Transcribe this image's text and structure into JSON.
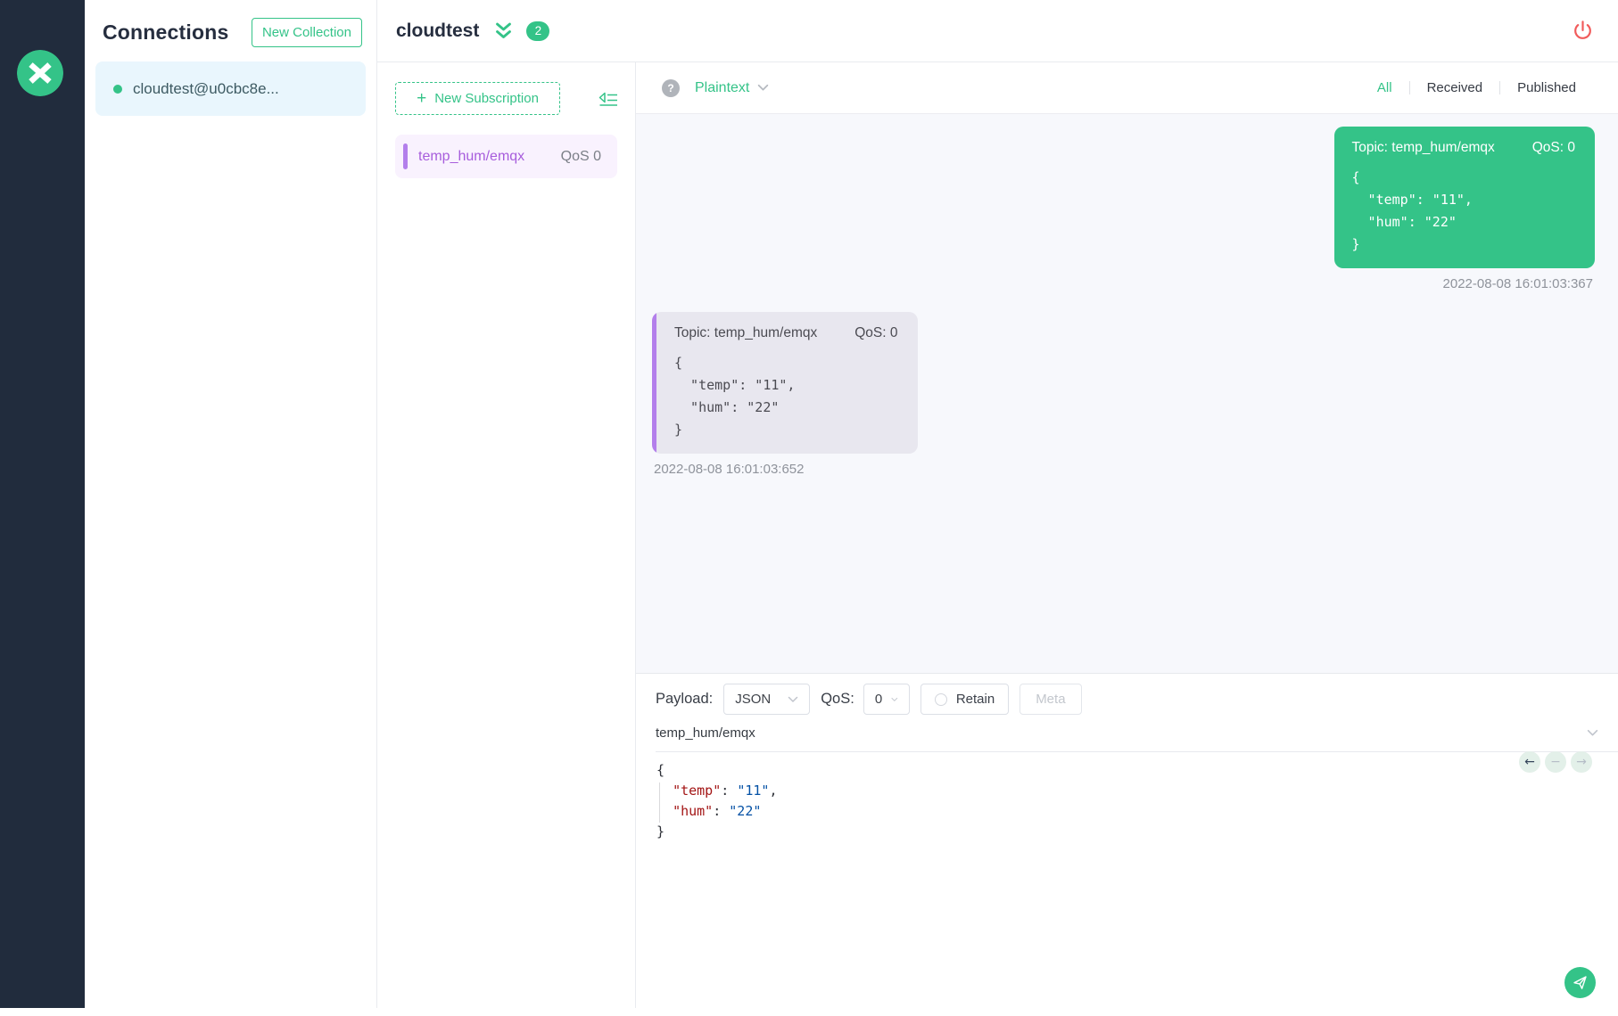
{
  "colors": {
    "brand_green": "#34c388",
    "purple": "#b37feb",
    "danger_red": "#f15b5b"
  },
  "connections_panel": {
    "title": "Connections",
    "new_collection_button": "New Collection",
    "items": [
      {
        "name": "cloudtest@u0cbc8e...",
        "status": "connected"
      }
    ]
  },
  "header": {
    "connection_title": "cloudtest",
    "subscriptions_badge": "2"
  },
  "subscriptions_panel": {
    "new_subscription_button": "New Subscription",
    "plus": "+",
    "items": [
      {
        "topic": "temp_hum/emqx",
        "qos": "QoS 0"
      }
    ]
  },
  "message_toolbar": {
    "help": "?",
    "format_selector": "Plaintext",
    "tabs": [
      {
        "label": "All",
        "active": true
      },
      {
        "label": "Received",
        "active": false
      },
      {
        "label": "Published",
        "active": false
      }
    ]
  },
  "messages": [
    {
      "direction": "published",
      "topic": "Topic: temp_hum/emqx",
      "qos": "QoS: 0",
      "payload": "{\n  \"temp\": \"11\",\n  \"hum\": \"22\"\n}",
      "timestamp": "2022-08-08 16:01:03:367"
    },
    {
      "direction": "received",
      "topic": "Topic: temp_hum/emqx",
      "qos": "QoS: 0",
      "payload": "{\n  \"temp\": \"11\",\n  \"hum\": \"22\"\n}",
      "timestamp": "2022-08-08 16:01:03:652"
    }
  ],
  "publish": {
    "payload_label": "Payload:",
    "payload_format_value": "JSON",
    "qos_label": "QoS:",
    "qos_value": "0",
    "retain_label": "Retain",
    "meta_button": "Meta",
    "topic_value": "temp_hum/emqx",
    "editor_lines": [
      [
        {
          "c": "pln",
          "t": "{"
        }
      ],
      [
        {
          "c": "pln",
          "t": "  "
        },
        {
          "c": "key",
          "t": "\"temp\""
        },
        {
          "c": "pln",
          "t": ": "
        },
        {
          "c": "str",
          "t": "\"11\""
        },
        {
          "c": "pln",
          "t": ","
        }
      ],
      [
        {
          "c": "pln",
          "t": "  "
        },
        {
          "c": "key",
          "t": "\"hum\""
        },
        {
          "c": "pln",
          "t": ": "
        },
        {
          "c": "str",
          "t": "\"22\""
        }
      ],
      [
        {
          "c": "pln",
          "t": "}"
        }
      ]
    ],
    "history": {
      "back": "←",
      "collapse": "−",
      "forward": "→"
    }
  }
}
